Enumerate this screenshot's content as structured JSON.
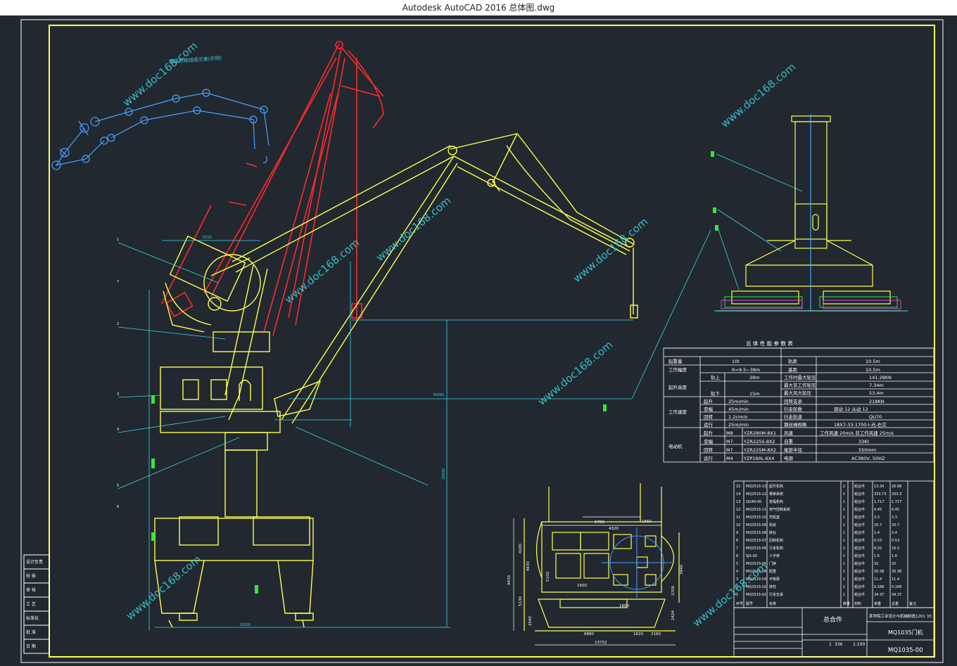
{
  "window": {
    "title": "Autodesk AutoCAD 2016     总体图.dwg"
  },
  "watermark": "www.doc168.com",
  "colors": {
    "background": "#212830",
    "yellow": "#ffff4d",
    "cyan": "#3fd6e0",
    "red": "#ff2a2a",
    "blue": "#4aa0ff",
    "green": "#35e835",
    "white": "#ffffff",
    "magenta": "#ff4aff"
  },
  "drawing": {
    "left_note": "变幅系统组成示意(示例)",
    "dims": {
      "boom_top": "5210",
      "base_width": "10500",
      "height_20500": "20500",
      "reach_35000": "35000",
      "plan_5780": "5780",
      "plan_4320": "4320",
      "plan_1560": "1560",
      "plan_1600": "1600",
      "plan_5100": "5100",
      "plan_4180": "4180",
      "plan_4630": "4630",
      "plan_3840": "3840",
      "plan_2706": "2706",
      "plan_2424": "2424",
      "plan_9430": "9430",
      "plan_5130": "5130",
      "plan_2040": "2040",
      "plan_1800": "1800",
      "plan_6880": "6880",
      "plan_1620": "1620",
      "plan_2160": "2160",
      "plan_13752": "13752",
      "pedestal_10500": "10500"
    },
    "side_labels": [
      "1",
      "2",
      "3",
      "4",
      "5",
      "6",
      "7"
    ]
  },
  "perf_table": {
    "title": "总 体 性 能 参 数 表",
    "rows": [
      [
        "起重量",
        "10t",
        "轨距",
        "10.5m"
      ],
      [
        "工作幅度",
        "R=9.5~38m",
        "基距",
        "10.5m"
      ],
      [
        "起升高度",
        "轨上",
        "28m",
        "工作时最大轮压",
        "141.28KN"
      ],
      [
        "",
        "轨下",
        "15m",
        "最大非工作轮压",
        "7.34m"
      ],
      [
        "",
        "",
        "",
        "最大风大轮压",
        "53.4m"
      ],
      [
        "工作速度",
        "起升",
        "25m/min",
        "回转支承",
        "218KN"
      ],
      [
        "",
        "变幅",
        "45m/min",
        "行走轮数",
        "驱动 12 从动 12"
      ],
      [
        "",
        "回转",
        "1.2r/min",
        "行走轨道",
        "QU70"
      ],
      [
        "",
        "运行",
        "25m/min",
        "钢丝绳规格",
        "18X7-33-1700-I-光-右交"
      ],
      [
        "电动机",
        "起升",
        "M8",
        "YZR280M-8X1",
        "风速",
        "工作风速 20m/s 非工作风速 25m/s"
      ],
      [
        "",
        "变幅",
        "M7",
        "YZR225S-8X2",
        "自重",
        "336t"
      ],
      [
        "",
        "回转",
        "M7",
        "YZR225M-8X2",
        "尾部半径",
        "550mm"
      ],
      [
        "",
        "运行",
        "M4",
        "YZP160L-6X4",
        "电源",
        "AC380V, 50HZ"
      ]
    ]
  },
  "parts_list": {
    "rows": [
      [
        "15",
        "MQ2533-13",
        "起升机构",
        "2",
        "",
        "组合件",
        "13.34",
        "26.68",
        ""
      ],
      [
        "14",
        "MQ2533-12",
        "臂架系统",
        "1",
        "",
        "组合件",
        "333.73",
        "333.3",
        ""
      ],
      [
        "13",
        "QG40-00",
        "变幅机构",
        "1",
        "",
        "组合件",
        "1.717",
        "1.717",
        ""
      ],
      [
        "12",
        "MQ2533-11",
        "电气控制系统",
        "1",
        "",
        "组合件",
        "0.45",
        "0.45",
        ""
      ],
      [
        "11",
        "MQ2533-10",
        "司机室",
        "1",
        "",
        "组合件",
        "3.3",
        "3.3",
        ""
      ],
      [
        "10",
        "MQ2533-09",
        "机房",
        "1",
        "",
        "组合件",
        "20.7",
        "20.7",
        ""
      ],
      [
        "9",
        "MQ2533-08",
        "转台",
        "1",
        "",
        "组合件",
        "2.4",
        "2.4",
        ""
      ],
      [
        "8",
        "MQ2533-07",
        "回转机构",
        "1",
        "",
        "组合件",
        "0.53",
        "0.53",
        ""
      ],
      [
        "7",
        "MQ2533-06",
        "行走机构",
        "2",
        "",
        "组合件",
        "8.25",
        "16.5",
        ""
      ],
      [
        "6",
        "SJS-00",
        "人字架",
        "1",
        "",
        "组合件",
        "1.6",
        "1.6",
        ""
      ],
      [
        "5",
        "MQ2533-05",
        "门架",
        "1",
        "",
        "组合件",
        "32",
        "32",
        ""
      ],
      [
        "4",
        "MQ2533-04",
        "配重",
        "1",
        "",
        "组合件",
        "30.38",
        "30.38",
        ""
      ],
      [
        "3",
        "MQ2533-03",
        "平衡梁",
        "1",
        "",
        "组合件",
        "11.4",
        "11.4",
        ""
      ],
      [
        "2",
        "MQ2533-02",
        "转柱",
        "1",
        "",
        "组合件",
        "0.168",
        "0.168",
        ""
      ],
      [
        "1",
        "MQ2533-01",
        "行走支承",
        "1",
        "",
        "组合件",
        "34.37",
        "34.37",
        ""
      ]
    ],
    "header": [
      "序号",
      "图号",
      "名称",
      "数量",
      "",
      "材料",
      "单重",
      "总重",
      "备注"
    ]
  },
  "title_block": {
    "name": "总合件",
    "org": "某学院工业设计与机械制造1201 33",
    "drawing_no": "MQ1035门机",
    "code": "MQ1035-00",
    "sheet": "1",
    "weight": "336",
    "scale": "1:100"
  },
  "left_stamp": [
    "设计负责",
    "校 核",
    "审 核",
    "工 艺",
    "标准化",
    "批 准",
    "日 期"
  ]
}
